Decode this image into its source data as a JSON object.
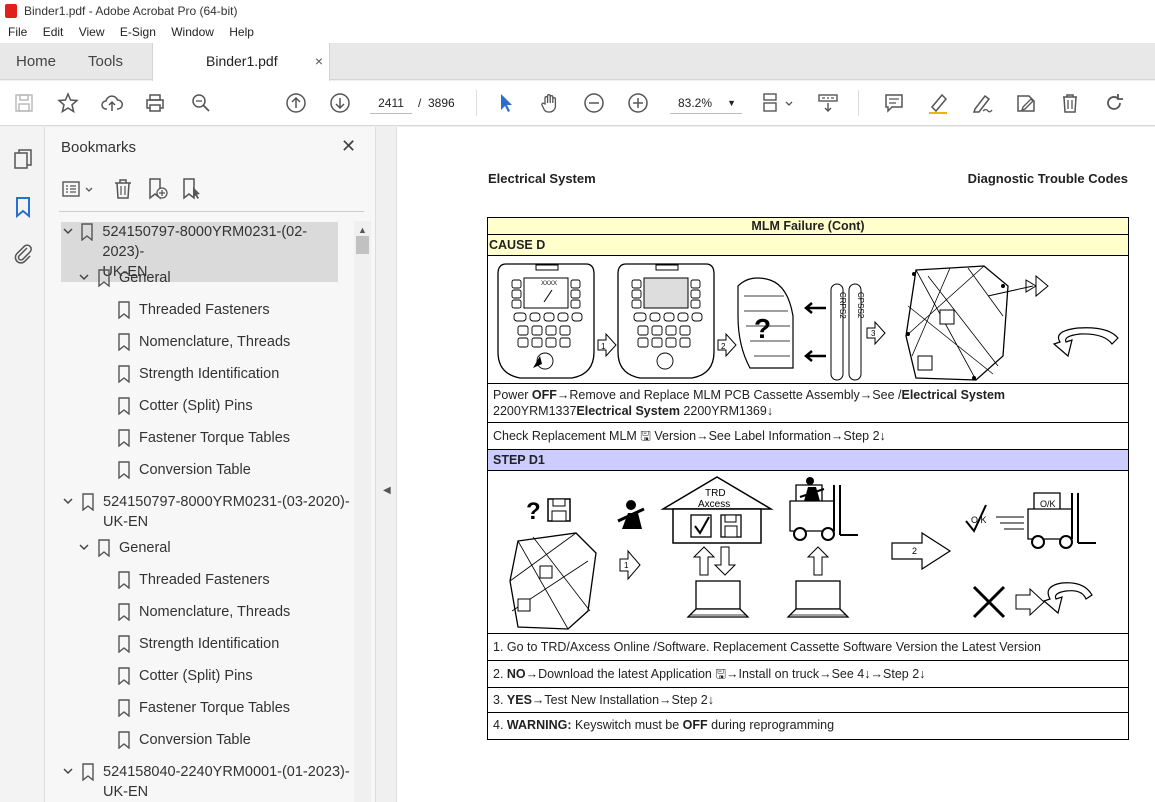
{
  "window": {
    "title": "Binder1.pdf - Adobe Acrobat Pro (64-bit)"
  },
  "menu": [
    "File",
    "Edit",
    "View",
    "E-Sign",
    "Window",
    "Help"
  ],
  "tabs": {
    "home": "Home",
    "tools": "Tools",
    "document": "Binder1.pdf",
    "close": "×"
  },
  "toolbar": {
    "page_current": "2411",
    "page_sep": "/",
    "page_total": "3896",
    "zoom": "83.2%"
  },
  "bookmarks": {
    "title": "Bookmarks",
    "close": "✕",
    "items": [
      {
        "label": "524150797-8000YRM0231-(02-2023)-",
        "label2": "UK-EN",
        "level": 0,
        "expanded": true,
        "selected": true
      },
      {
        "label": "General",
        "level": 1,
        "expanded": true
      },
      {
        "label": "Threaded Fasteners",
        "level": 2
      },
      {
        "label": "Nomenclature, Threads",
        "level": 2
      },
      {
        "label": "Strength Identification",
        "level": 2
      },
      {
        "label": "Cotter (Split) Pins",
        "level": 2
      },
      {
        "label": "Fastener Torque Tables",
        "level": 2
      },
      {
        "label": "Conversion Table",
        "level": 2
      },
      {
        "label": "524150797-8000YRM0231-(03-2020)-",
        "label2": "UK-EN",
        "level": 0,
        "expanded": true
      },
      {
        "label": "General",
        "level": 1,
        "expanded": true
      },
      {
        "label": "Threaded Fasteners",
        "level": 2
      },
      {
        "label": "Nomenclature, Threads",
        "level": 2
      },
      {
        "label": "Strength Identification",
        "level": 2
      },
      {
        "label": "Cotter (Split) Pins",
        "level": 2
      },
      {
        "label": "Fastener Torque Tables",
        "level": 2
      },
      {
        "label": "Conversion Table",
        "level": 2
      },
      {
        "label": "524158040-2240YRM0001-(01-2023)-",
        "label2": "UK-EN",
        "level": 0,
        "expanded": true
      }
    ]
  },
  "document": {
    "header_left": "Electrical System",
    "header_right": "Diagnostic Trouble Codes",
    "table_title": "MLM Failure (Cont)",
    "cause": "CAUSE D",
    "img1_labels": {
      "keypad": "XXXX",
      "step1": "1",
      "step2": "2",
      "step3": "3",
      "crps": "CRPS2",
      "cpss": "CPSS2",
      "q": "?"
    },
    "cause_text": {
      "a": "Power ",
      "b": "OFF",
      "c": "→Remove and Replace MLM PCB Cassette Assembly→See /",
      "d": "Electrical System",
      "e": "2200YRM1337",
      "f": "Electrical System",
      "g": " 2200YRM1369↓"
    },
    "check_text": "Check Replacement MLM 🖫 Version→See Label Information→Step 2↓",
    "step": "STEP D1",
    "img2_labels": {
      "trd1": "TRD",
      "trd2": "Axcess",
      "q": "?",
      "n1": "1",
      "n2": "2",
      "ok1": "O/K",
      "ok2": "O/K"
    },
    "lines": {
      "l1": "1. Go to TRD/Axcess Online /Software. Replacement Cassette Software Version the Latest Version",
      "l2a": "2. ",
      "l2b": "NO",
      "l2c": "→Download the latest Application 🖫→Install on truck→See 4↓→Step 2↓",
      "l3a": "3. ",
      "l3b": "YES",
      "l3c": "→Test New Installation→Step 2↓",
      "l4a": "4. ",
      "l4b": "WARNING:",
      "l4c": " Keyswitch must be ",
      "l4d": "OFF",
      "l4e": " during reprogramming"
    }
  }
}
